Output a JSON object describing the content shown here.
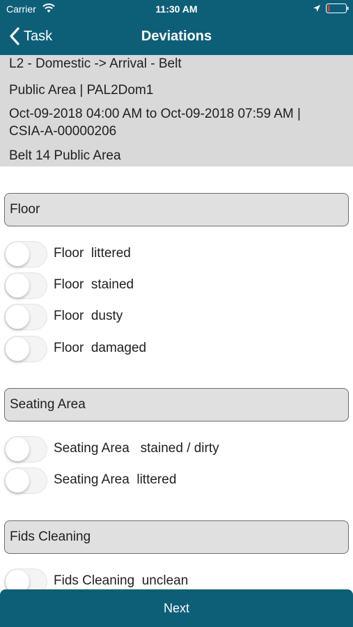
{
  "status_bar": {
    "carrier": "Carrier",
    "time": "11:30 AM",
    "wifi_icon": "wifi-icon",
    "location_icon": "location-arrow-icon",
    "battery_icon": "battery-low-icon"
  },
  "nav": {
    "back_label": "Task",
    "back_icon": "chevron-left-icon",
    "title": "Deviations"
  },
  "info": {
    "line1": "L2 - Domestic -> Arrival - Belt",
    "line2": "Public Area  |    PAL2Dom1",
    "line3": "Oct-09-2018 04:00 AM to Oct-09-2018 07:59 AM |",
    "line4": "CSIA-A-00000206",
    "line5": "Belt 14 Public Area"
  },
  "sections": [
    {
      "title": "Floor",
      "items": [
        {
          "label": "Floor  littered",
          "on": false
        },
        {
          "label": "Floor  stained",
          "on": false
        },
        {
          "label": "Floor  dusty",
          "on": false
        },
        {
          "label": "Floor  damaged",
          "on": false
        }
      ]
    },
    {
      "title": "Seating Area",
      "items": [
        {
          "label": "Seating Area   stained / dirty",
          "on": false
        },
        {
          "label": "Seating Area  littered",
          "on": false
        }
      ]
    },
    {
      "title": "Fids Cleaning",
      "items": [
        {
          "label": "Fids Cleaning  unclean",
          "on": false
        }
      ]
    }
  ],
  "footer": {
    "next_label": "Next"
  },
  "colors": {
    "header": "#0d5f78",
    "panel": "#d9d9d9",
    "section_bg": "#e0e0e0"
  }
}
